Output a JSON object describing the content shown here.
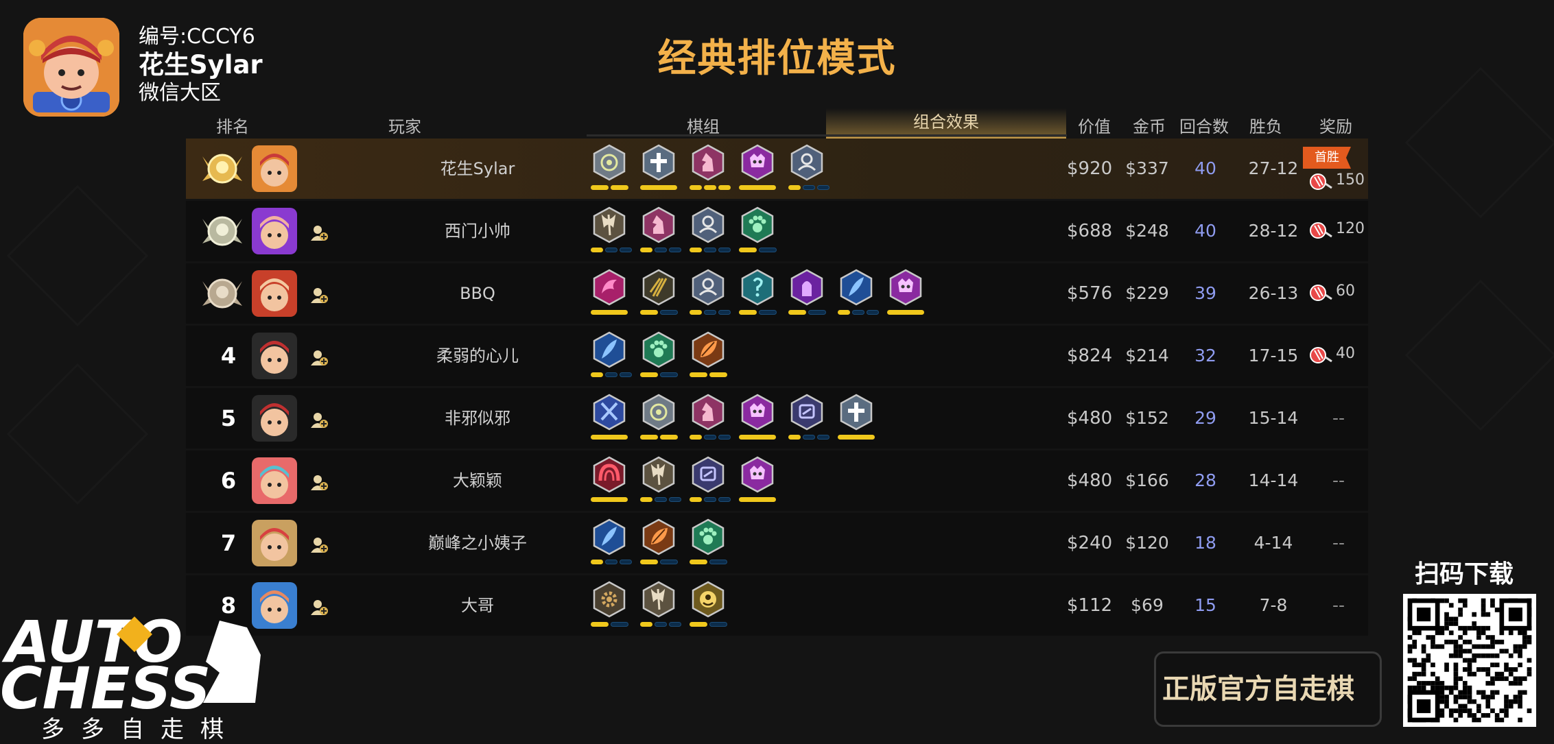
{
  "player": {
    "id_label": "编号:CCCY6",
    "name": "花生Sylar",
    "region": "微信大区"
  },
  "title": "经典排位模式",
  "columns": {
    "rank": "排名",
    "player": "玩家",
    "pieces": "棋组",
    "synergy": "组合效果",
    "worth": "价值",
    "gold": "金币",
    "rounds": "回合数",
    "winloss": "胜负",
    "reward": "奖励"
  },
  "rows": [
    {
      "rank": "",
      "medal": "gold",
      "name": "花生Sylar",
      "friend": false,
      "avatar": "orange-hat",
      "synergies": [
        {
          "icon": "beast-icon",
          "color": "#6f7a86",
          "glyph": "#e3e8a0",
          "pips": [
            1,
            1
          ]
        },
        {
          "icon": "cross-icon",
          "color": "#5a6c80",
          "glyph": "#ffffff",
          "pips": [
            1
          ]
        },
        {
          "icon": "knight-icon",
          "color": "#8e3464",
          "glyph": "#f5b8cf",
          "pips": [
            1,
            1,
            1
          ]
        },
        {
          "icon": "demon-icon",
          "color": "#8a2aa0",
          "glyph": "#f6c1ff",
          "pips": [
            1
          ]
        },
        {
          "icon": "human-icon",
          "color": "#50607a",
          "glyph": "#e6e6e6",
          "pips": [
            1,
            0,
            0
          ]
        }
      ],
      "worth": "$920",
      "gold": "$337",
      "rounds": "40",
      "winloss": "27-12",
      "first_win": "首胜",
      "reward": "150"
    },
    {
      "rank": "",
      "medal": "silver",
      "name": "西门小帅",
      "friend": true,
      "avatar": "purple",
      "synergies": [
        {
          "icon": "axe-icon",
          "color": "#5c5240",
          "glyph": "#e8dcc4",
          "pips": [
            1,
            0,
            0
          ]
        },
        {
          "icon": "knight-icon",
          "color": "#8e3464",
          "glyph": "#f5b8cf",
          "pips": [
            1,
            0,
            0
          ]
        },
        {
          "icon": "human-icon",
          "color": "#50607a",
          "glyph": "#e6e6e6",
          "pips": [
            1,
            0,
            0
          ]
        },
        {
          "icon": "paw-icon",
          "color": "#1f7a55",
          "glyph": "#9ef0c0",
          "pips": [
            1,
            0
          ]
        }
      ],
      "worth": "$688",
      "gold": "$248",
      "rounds": "40",
      "winloss": "28-12",
      "reward": "120"
    },
    {
      "rank": "",
      "medal": "bronze",
      "name": "BBQ",
      "friend": true,
      "avatar": "red-frame",
      "synergies": [
        {
          "icon": "dragon-icon",
          "color": "#a8206a",
          "glyph": "#ff8ac8",
          "pips": [
            1
          ]
        },
        {
          "icon": "trident-icon",
          "color": "#3e3a2a",
          "glyph": "#d6b040",
          "pips": [
            1,
            0
          ]
        },
        {
          "icon": "human-icon",
          "color": "#50607a",
          "glyph": "#e6e6e6",
          "pips": [
            1,
            0,
            0
          ]
        },
        {
          "icon": "mage-icon",
          "color": "#1e6e78",
          "glyph": "#9ff0f0",
          "pips": [
            1,
            0
          ]
        },
        {
          "icon": "wizard-icon",
          "color": "#6b22a0",
          "glyph": "#e0a8ff",
          "pips": [
            1,
            0
          ]
        },
        {
          "icon": "feather-icon",
          "color": "#1f4e96",
          "glyph": "#8cc4ff",
          "pips": [
            1,
            0,
            0
          ]
        },
        {
          "icon": "demon-icon",
          "color": "#8a2aa0",
          "glyph": "#f6c1ff",
          "pips": [
            1
          ]
        }
      ],
      "worth": "$576",
      "gold": "$229",
      "rounds": "39",
      "winloss": "26-13",
      "reward": "60"
    },
    {
      "rank": "4",
      "medal": "",
      "name": "柔弱的心儿",
      "friend": true,
      "avatar": "ninja",
      "synergies": [
        {
          "icon": "feather-icon",
          "color": "#1f4e96",
          "glyph": "#8cc4ff",
          "pips": [
            1,
            0,
            0
          ]
        },
        {
          "icon": "paw-icon",
          "color": "#1f7a55",
          "glyph": "#9ef0c0",
          "pips": [
            1,
            0
          ]
        },
        {
          "icon": "leaf-icon",
          "color": "#7a3a14",
          "glyph": "#ff9a4a",
          "pips": [
            1,
            1
          ]
        }
      ],
      "worth": "$824",
      "gold": "$214",
      "rounds": "32",
      "winloss": "17-15",
      "reward": "40"
    },
    {
      "rank": "5",
      "medal": "",
      "name": "非邪似邪",
      "friend": true,
      "avatar": "ninja",
      "synergies": [
        {
          "icon": "swords-icon",
          "color": "#2e4aa0",
          "glyph": "#a8c8ff",
          "pips": [
            1
          ]
        },
        {
          "icon": "beast-icon",
          "color": "#6f7a86",
          "glyph": "#e3e8a0",
          "pips": [
            1,
            1
          ]
        },
        {
          "icon": "knight-icon",
          "color": "#8e3464",
          "glyph": "#f5b8cf",
          "pips": [
            1,
            0,
            0
          ]
        },
        {
          "icon": "demon-icon",
          "color": "#8a2aa0",
          "glyph": "#f6c1ff",
          "pips": [
            1
          ]
        },
        {
          "icon": "goblin-icon",
          "color": "#3a3a6e",
          "glyph": "#c4c4ff",
          "pips": [
            1,
            0,
            0
          ]
        },
        {
          "icon": "cross-icon",
          "color": "#5a6c80",
          "glyph": "#ffffff",
          "pips": [
            1
          ]
        }
      ],
      "worth": "$480",
      "gold": "$152",
      "rounds": "29",
      "winloss": "15-14",
      "reward": "--"
    },
    {
      "rank": "6",
      "medal": "",
      "name": "大颖颖",
      "friend": true,
      "avatar": "goggles",
      "synergies": [
        {
          "icon": "arch-icon",
          "color": "#7a1a2a",
          "glyph": "#ff5a6a",
          "pips": [
            1
          ]
        },
        {
          "icon": "axe-icon",
          "color": "#5c5240",
          "glyph": "#e8dcc4",
          "pips": [
            1,
            0,
            0
          ]
        },
        {
          "icon": "goblin-icon",
          "color": "#3a3a6e",
          "glyph": "#c4c4ff",
          "pips": [
            1,
            0,
            0
          ]
        },
        {
          "icon": "demon-icon",
          "color": "#8a2aa0",
          "glyph": "#f6c1ff",
          "pips": [
            1
          ]
        }
      ],
      "worth": "$480",
      "gold": "$166",
      "rounds": "28",
      "winloss": "14-14",
      "reward": "--"
    },
    {
      "rank": "7",
      "medal": "",
      "name": "巅峰之小姨子",
      "friend": true,
      "avatar": "dragon",
      "synergies": [
        {
          "icon": "feather-icon",
          "color": "#1f4e96",
          "glyph": "#8cc4ff",
          "pips": [
            1,
            0,
            0
          ]
        },
        {
          "icon": "leaf-icon",
          "color": "#7a3a14",
          "glyph": "#ff9a4a",
          "pips": [
            1,
            0
          ]
        },
        {
          "icon": "paw-icon",
          "color": "#1f7a55",
          "glyph": "#9ef0c0",
          "pips": [
            1,
            0
          ]
        }
      ],
      "worth": "$240",
      "gold": "$120",
      "rounds": "18",
      "winloss": "4-14",
      "reward": "--"
    },
    {
      "rank": "8",
      "medal": "",
      "name": "大哥",
      "friend": true,
      "avatar": "boy",
      "synergies": [
        {
          "icon": "gear-icon",
          "color": "#4a4030",
          "glyph": "#d4a860",
          "pips": [
            1,
            0
          ]
        },
        {
          "icon": "axe-icon",
          "color": "#5c5240",
          "glyph": "#e8dcc4",
          "pips": [
            1,
            0,
            0
          ]
        },
        {
          "icon": "eye-icon",
          "color": "#6e5a1e",
          "glyph": "#f5d46a",
          "pips": [
            1,
            0
          ]
        }
      ],
      "worth": "$112",
      "gold": "$69",
      "rounds": "15",
      "winloss": "7-8",
      "reward": "--"
    }
  ],
  "branding": {
    "logo_line1": "AUTO",
    "logo_line2": "CHESS",
    "logo_sub": "多多自走棋",
    "scan_label": "扫码下载",
    "banner": "正版官方自走棋"
  },
  "colors": {
    "title": "#f3b14a",
    "rounds": "#8f9cf0",
    "pip_on": "#f0c81c",
    "pip_off": "#0c2c4a"
  }
}
